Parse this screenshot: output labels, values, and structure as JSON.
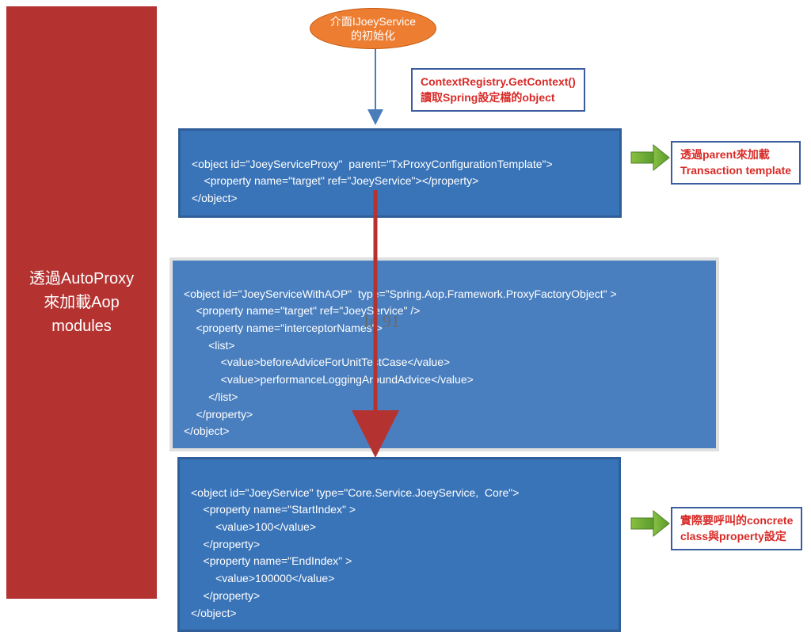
{
  "sidebar": {
    "line1": "透過AutoProxy",
    "line2": "來加載Aop",
    "line3": "modules"
  },
  "ellipse": {
    "line1": "介面IJoeyService",
    "line2": "的初始化"
  },
  "callout_top": {
    "line1": "ContextRegistry.GetContext()",
    "line2": "讀取Spring設定檔的object"
  },
  "box1": {
    "l1": "<object id=\"JoeyServiceProxy\"  parent=\"TxProxyConfigurationTemplate\">",
    "l2": "    <property name=\"target\" ref=\"JoeyService\"></property>",
    "l3": "</object>"
  },
  "callout_right1": {
    "line1": "透過parent來加載",
    "line2": "Transaction template"
  },
  "box2": {
    "l1": "<object id=\"JoeyServiceWithAOP\"  type=\"Spring.Aop.Framework.ProxyFactoryObject\" >",
    "l2": "    <property name=\"target\" ref=\"JoeyService\" />",
    "l3": "    <property name=\"interceptorNames\">",
    "l4": "        <list>",
    "l5": "            <value>beforeAdviceForUnitTestCase</value>",
    "l6": "            <value>performanceLoggingAroundAdvice</value>",
    "l7": "        </list>",
    "l8": "    </property>",
    "l9": "</object>"
  },
  "box3": {
    "l1": "<object id=\"JoeyService\" type=\"Core.Service.JoeyService,  Core\">",
    "l2": "    <property name=\"StartIndex\" >",
    "l3": "        <value>100</value>",
    "l4": "    </property>",
    "l5": "    <property name=\"EndIndex\" >",
    "l6": "        <value>100000</value>",
    "l7": "    </property>",
    "l8": "</object>"
  },
  "callout_right2": {
    "line1": "實際要呼叫的concrete",
    "line2": "class與property設定"
  },
  "watermark": "In 91"
}
